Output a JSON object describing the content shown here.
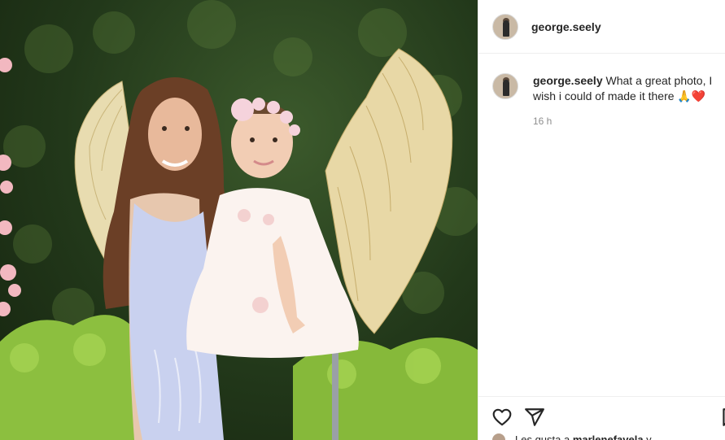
{
  "post": {
    "author": "george.seely",
    "photo_alt": "Photo"
  },
  "comments": [
    {
      "user": "george.seely",
      "text": " What a great photo, I wish i could of made it there 🙏❤️",
      "time": "16 h"
    }
  ],
  "likes": {
    "prefix": "Les gusta a ",
    "user": "marlenefavela",
    "suffix": " y"
  },
  "icons": {
    "like": "heart-icon",
    "share": "paper-plane-icon",
    "save": "bookmark-icon"
  },
  "colors": {
    "text": "#262626",
    "muted": "#8e8e8e",
    "border": "#efefef"
  }
}
